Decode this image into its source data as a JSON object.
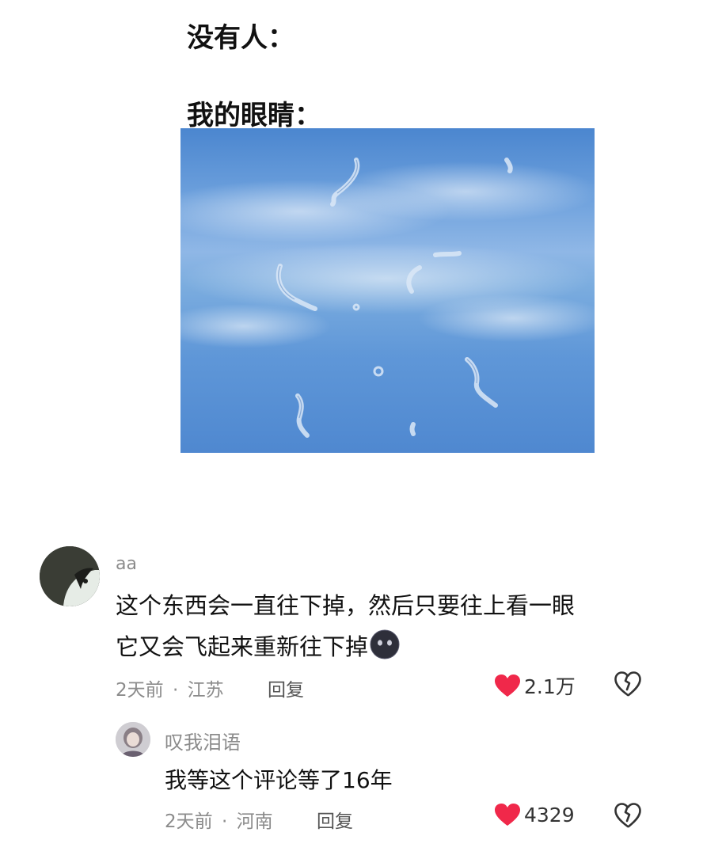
{
  "meme": {
    "caption_top": "没有人：",
    "caption_bottom": "我的眼睛："
  },
  "comments": [
    {
      "author": "aa",
      "text_line1": "这个东西会一直往下掉，然后只要往上看一眼",
      "text_line2": "它又会飞起来重新往下掉",
      "emoji_icon": "dark-face-emoji-icon",
      "time": "2天前",
      "separator": "·",
      "location": "江苏",
      "reply_label": "回复",
      "likes": "2.1万"
    },
    {
      "author": "叹我泪语",
      "text_line1": "我等这个评论等了16年",
      "time": "2天前",
      "separator": "·",
      "location": "河南",
      "reply_label": "回复",
      "likes": "4329"
    }
  ],
  "colors": {
    "like_heart": "#f0284a",
    "meta_gray": "#8b8b8b",
    "sky_blue": "#6b9fdc"
  }
}
